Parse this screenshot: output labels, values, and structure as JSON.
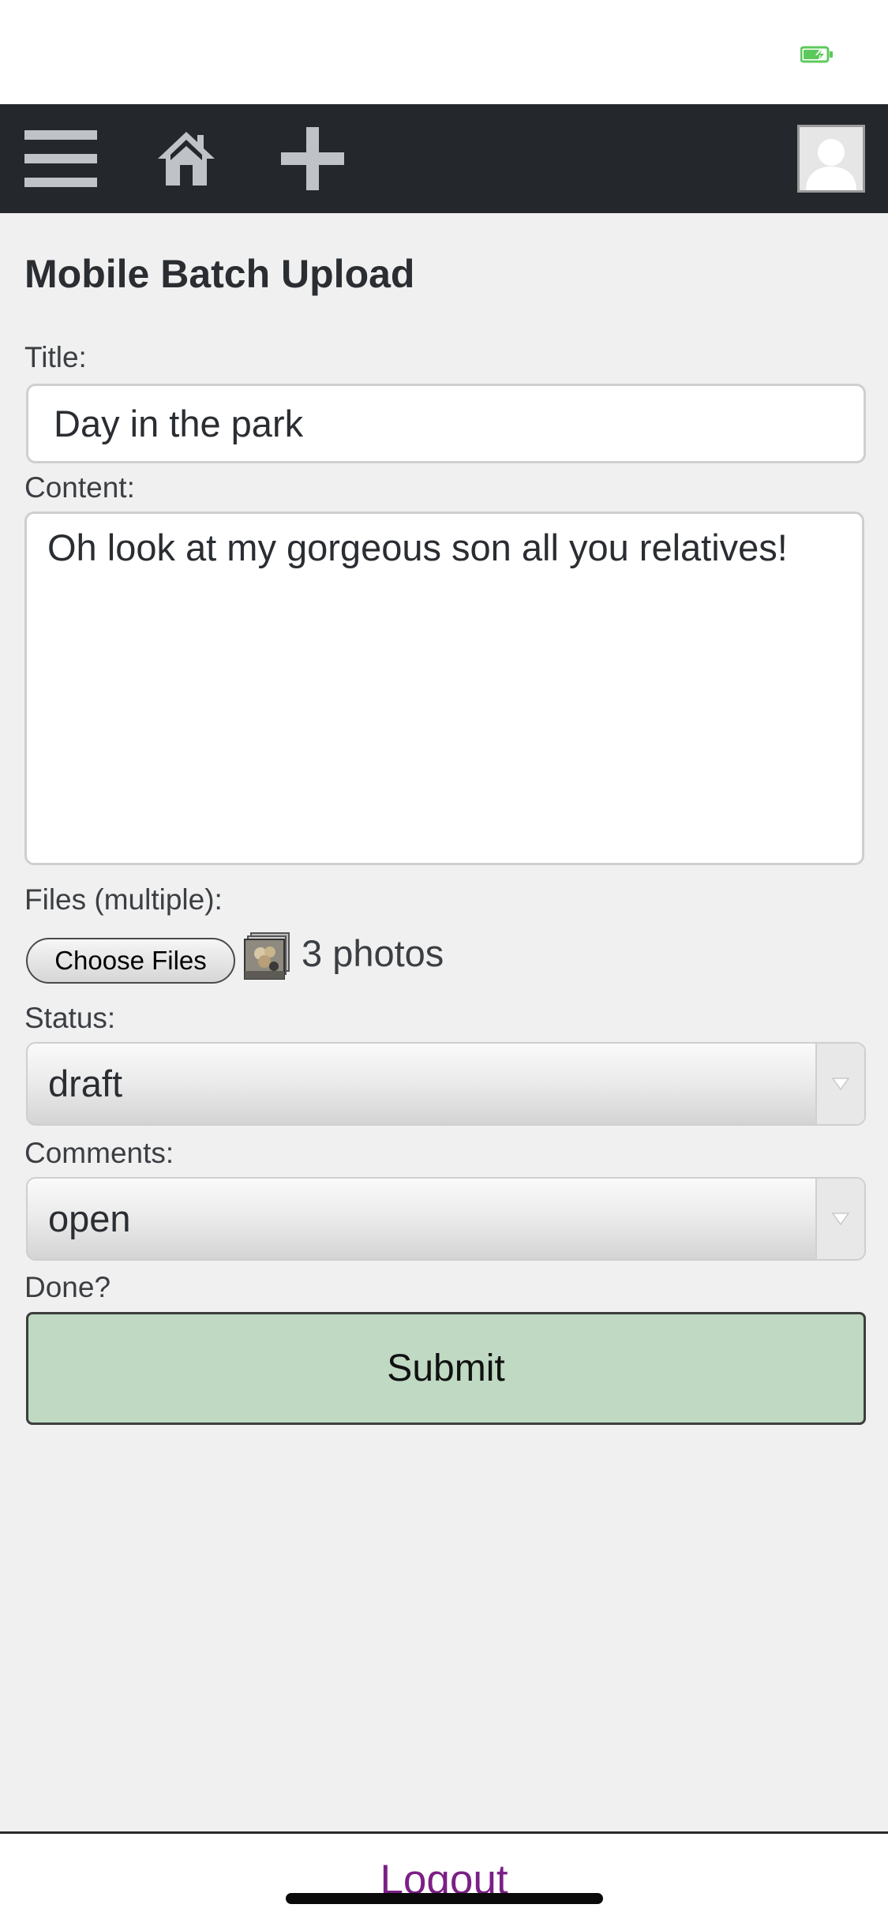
{
  "header": {
    "menu_icon": "hamburger-menu-icon",
    "home_icon": "home-icon",
    "add_icon": "plus-icon",
    "avatar_icon": "user-silhouette-icon",
    "background_color": "#24272c",
    "icon_color": "#bfc2c6"
  },
  "status_bar": {
    "battery_icon": "battery-charging-icon",
    "battery_color": "#5cc95a"
  },
  "page": {
    "title": "Mobile Batch Upload"
  },
  "form": {
    "title_label": "Title:",
    "title_value": "Day in the park",
    "content_label": "Content:",
    "content_value": "Oh look at my gorgeous son all you relatives!",
    "files_label": "Files (multiple):",
    "choose_files_label": "Choose Files",
    "files_selected": "3 photos",
    "status_label": "Status:",
    "status_value": "draft",
    "comments_label": "Comments:",
    "comments_value": "open",
    "done_label": "Done?",
    "submit_label": "Submit",
    "submit_color": "#bfd9c2"
  },
  "footer": {
    "logout_label": "Logout",
    "logout_color": "#7b1f86"
  }
}
